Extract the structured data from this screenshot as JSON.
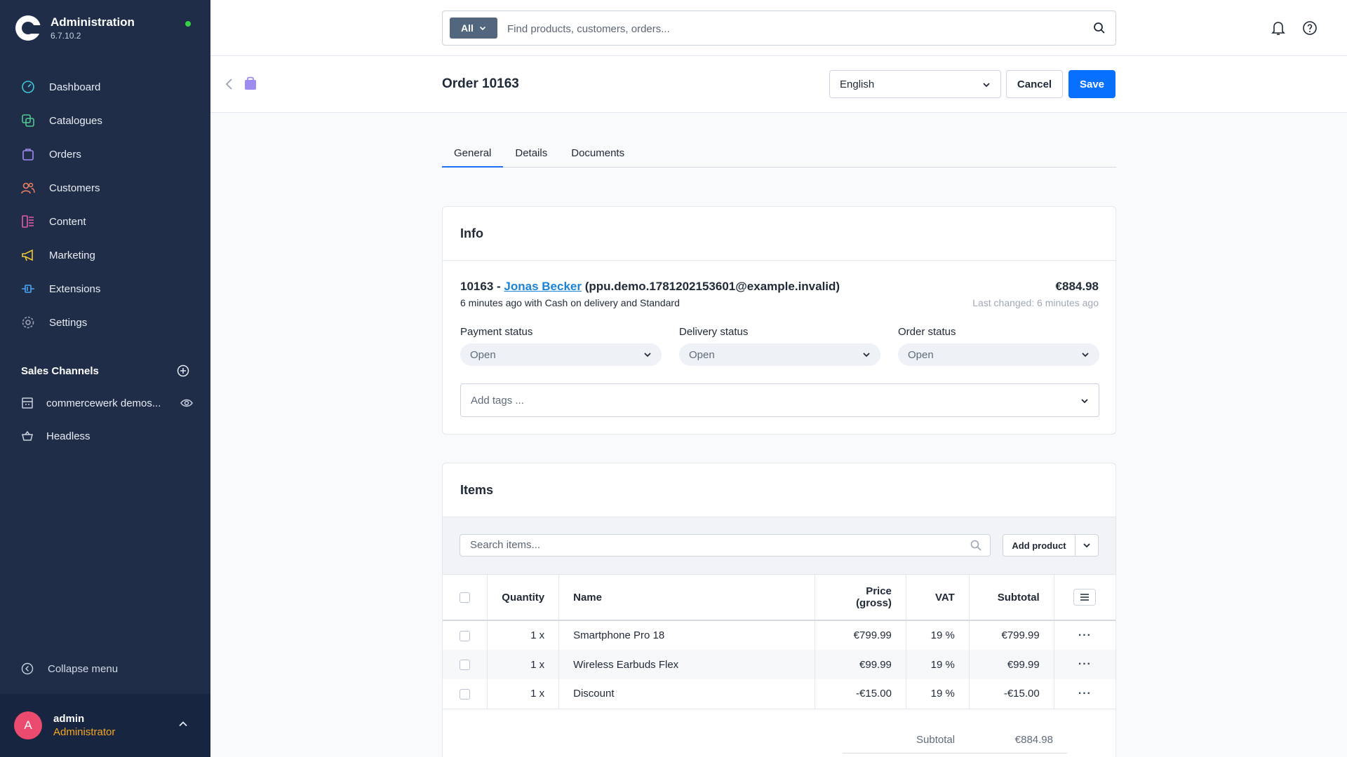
{
  "app": {
    "title": "Administration",
    "version": "6.7.10.2",
    "colors": {
      "sidebar": "#1f2d48",
      "accent": "#0870ff",
      "online": "#37d046"
    }
  },
  "sidebar": {
    "items": [
      {
        "label": "Dashboard",
        "icon": "gauge-icon"
      },
      {
        "label": "Catalogues",
        "icon": "catalogue-icon"
      },
      {
        "label": "Orders",
        "icon": "shopping-bag-icon"
      },
      {
        "label": "Customers",
        "icon": "users-icon"
      },
      {
        "label": "Content",
        "icon": "content-icon"
      },
      {
        "label": "Marketing",
        "icon": "megaphone-icon"
      },
      {
        "label": "Extensions",
        "icon": "plug-icon"
      },
      {
        "label": "Settings",
        "icon": "gear-icon"
      }
    ],
    "sales_channels_title": "Sales Channels",
    "sales_channels": [
      {
        "label": "commercewerk demos...",
        "icon": "storefront-icon"
      },
      {
        "label": "Headless",
        "icon": "basket-icon"
      }
    ],
    "collapse_label": "Collapse menu",
    "user": {
      "initial": "A",
      "name": "admin",
      "role": "Administrator"
    }
  },
  "search": {
    "scope": "All",
    "placeholder": "Find products, customers, orders..."
  },
  "header": {
    "title": "Order 10163",
    "language": "English",
    "cancel_label": "Cancel",
    "save_label": "Save"
  },
  "tabs": [
    "General",
    "Details",
    "Documents"
  ],
  "info": {
    "title": "Info",
    "order_number_prefix": "10163 -",
    "customer_name": "Jonas Becker",
    "customer_email": "(ppu.demo.1781202153601@example.invalid)",
    "subline": "6 minutes ago with Cash on delivery and Standard",
    "total": "€884.98",
    "last_changed": "Last changed: 6 minutes ago",
    "payment_status": {
      "label": "Payment status",
      "value": "Open"
    },
    "delivery_status": {
      "label": "Delivery status",
      "value": "Open"
    },
    "order_status": {
      "label": "Order status",
      "value": "Open"
    },
    "tags_placeholder": "Add tags ..."
  },
  "items": {
    "title": "Items",
    "search_placeholder": "Search items...",
    "add_product_label": "Add product",
    "columns": [
      "Quantity",
      "Name",
      "Price (gross)",
      "VAT",
      "Subtotal"
    ],
    "rows": [
      {
        "quantity": "1 x",
        "name": "Smartphone Pro 18",
        "price": "€799.99",
        "vat": "19 %",
        "subtotal": "€799.99"
      },
      {
        "quantity": "1 x",
        "name": "Wireless Earbuds Flex",
        "price": "€99.99",
        "vat": "19 %",
        "subtotal": "€99.99"
      },
      {
        "quantity": "1 x",
        "name": "Discount",
        "price": "-€15.00",
        "vat": "19 %",
        "subtotal": "-€15.00"
      }
    ],
    "summary_label": "Subtotal",
    "summary_value": "€884.98"
  }
}
